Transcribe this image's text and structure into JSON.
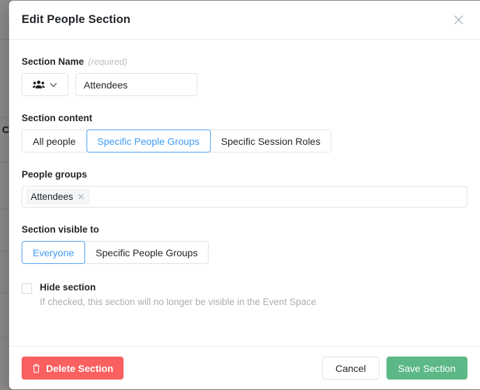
{
  "modal": {
    "title": "Edit People Section",
    "close_icon": "close-icon",
    "section_name": {
      "label": "Section Name",
      "required_hint": "(required)",
      "icon": "people-group-icon",
      "chevron_icon": "chevron-down-icon",
      "value": "Attendees",
      "placeholder": "Attendees"
    },
    "section_content": {
      "label": "Section content",
      "options": [
        {
          "label": "All people",
          "selected": false
        },
        {
          "label": "Specific People Groups",
          "selected": true
        },
        {
          "label": "Specific Session Roles",
          "selected": false
        }
      ]
    },
    "people_groups": {
      "label": "People groups",
      "tags": [
        {
          "label": "Attendees",
          "remove_icon": "close-icon"
        }
      ]
    },
    "section_visible_to": {
      "label": "Section visible to",
      "options": [
        {
          "label": "Everyone",
          "selected": true
        },
        {
          "label": "Specific People Groups",
          "selected": false
        }
      ]
    },
    "hide_section": {
      "label": "Hide section",
      "help": "If checked, this section will no longer be visible in the Event Space",
      "checked": false
    },
    "footer": {
      "delete_label": "Delete Section",
      "delete_icon": "trash-icon",
      "cancel_label": "Cancel",
      "save_label": "Save Section"
    }
  },
  "background": {
    "fragment": "C"
  },
  "colors": {
    "accent_blue": "#3d9bf7",
    "danger_red": "#f9605f",
    "success_green": "#5cb887",
    "scrim": "#8c8c8c"
  }
}
